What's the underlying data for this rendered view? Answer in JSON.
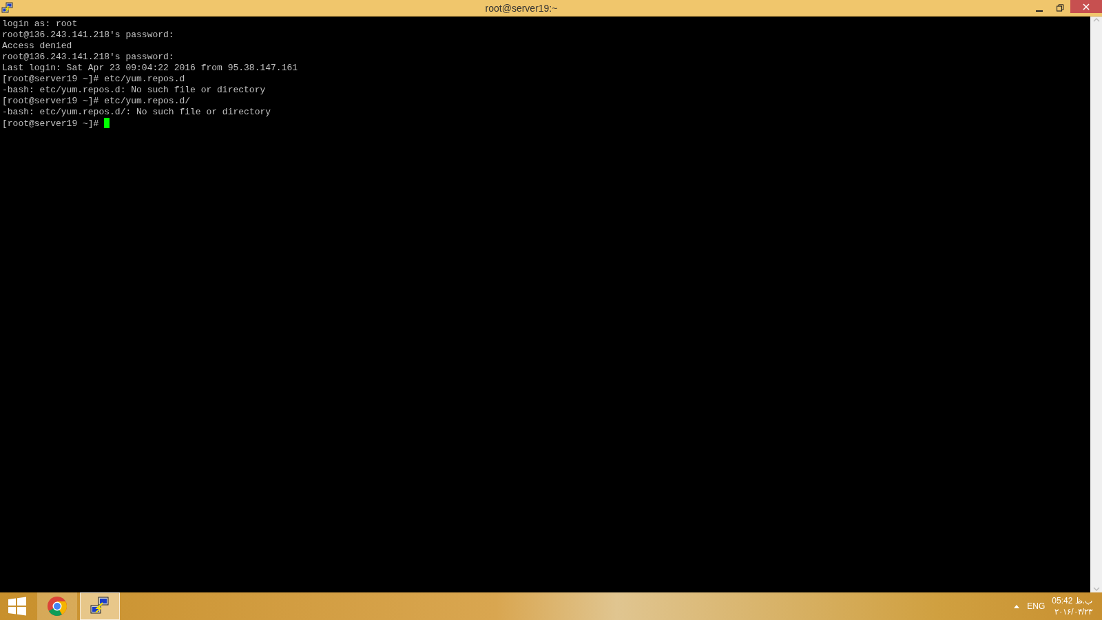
{
  "window": {
    "title": "root@server19:~"
  },
  "terminal": {
    "lines": [
      "login as: root",
      "root@136.243.141.218's password:",
      "Access denied",
      "root@136.243.141.218's password:",
      "Last login: Sat Apr 23 09:04:22 2016 from 95.38.147.161",
      "[root@server19 ~]# etc/yum.repos.d",
      "-bash: etc/yum.repos.d: No such file or directory",
      "[root@server19 ~]# etc/yum.repos.d/",
      "-bash: etc/yum.repos.d/: No such file or directory",
      "[root@server19 ~]# "
    ]
  },
  "taskbar": {
    "apps": [
      {
        "kind": "browser",
        "selected": false
      },
      {
        "kind": "terminal",
        "selected": true
      }
    ],
    "language": "ENG",
    "time": "ب.ظ 05:42",
    "date": "۲۰۱۶/۰۴/۲۳"
  }
}
